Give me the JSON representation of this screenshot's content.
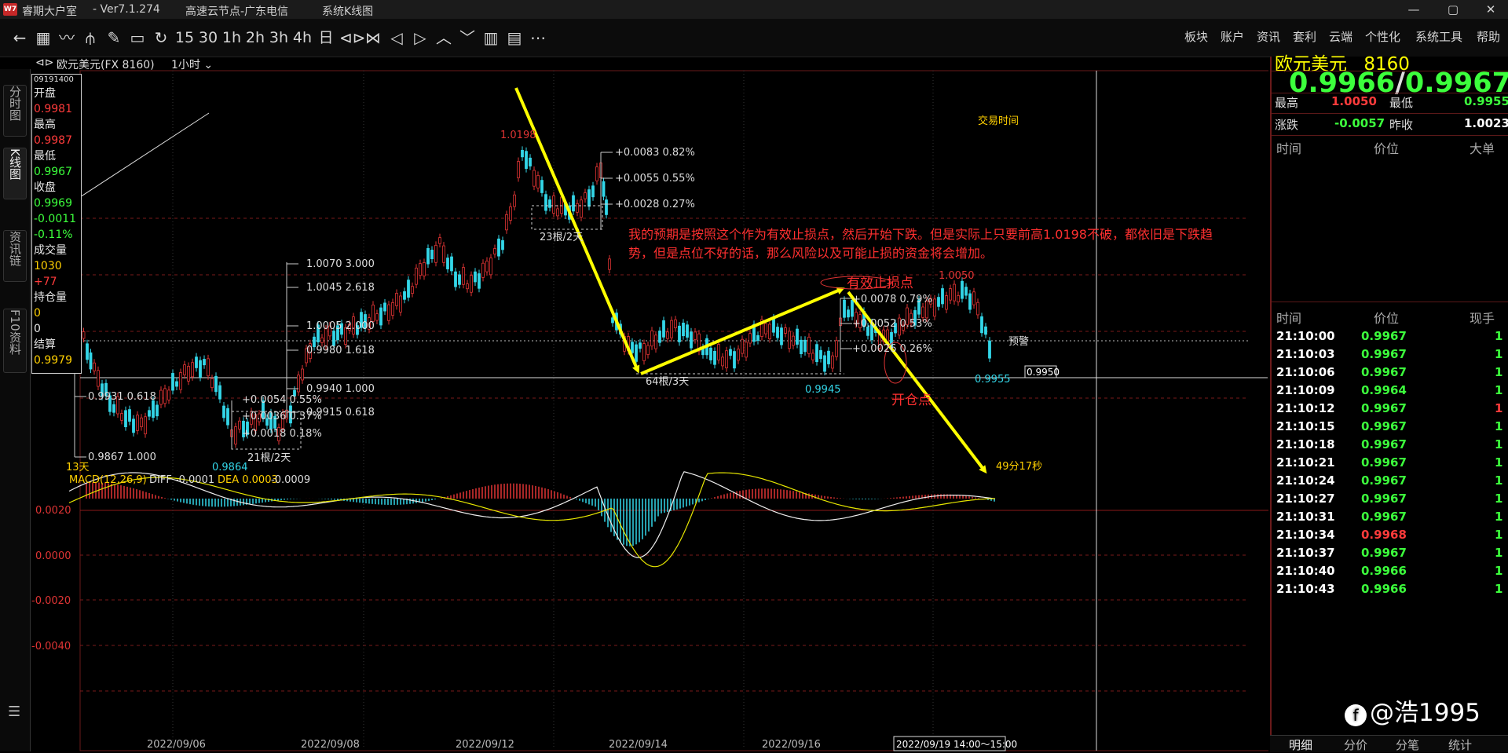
{
  "window": {
    "app_name": "睿期大户室",
    "version": "-  Ver7.1.274",
    "server": "高速云节点-广东电信",
    "module": "系统K线图",
    "logo": "app-logo",
    "controls": [
      "—",
      "▢",
      "✕"
    ]
  },
  "toolbar": {
    "tools": [
      "←",
      "▦",
      "〰",
      "⫛",
      "✎",
      "▭",
      "↻",
      "15",
      "30",
      "1h",
      "2h",
      "3h",
      "4h",
      "日",
      "⊲⊳",
      "⋈",
      "◁",
      "▷",
      "︿",
      "﹀",
      "▥",
      "▤",
      "⋯"
    ],
    "menu": [
      "板块",
      "账户",
      "资讯",
      "套利",
      "云端",
      "个性化",
      "系统工具",
      "帮助"
    ]
  },
  "side_tabs": [
    "分时图",
    "K线图",
    "资讯链",
    "F10资料"
  ],
  "symbol_header": {
    "symbol": "欧元美元(FX 8160)",
    "period": "1小时",
    "trade_time": "交易时间"
  },
  "info_box": {
    "timestamp": "09191400",
    "open_label": "开盘",
    "open": "0.9981",
    "high_label": "最高",
    "high": "0.9987",
    "low_label": "最低",
    "low": "0.9967",
    "close_label": "收盘",
    "close": "0.9969",
    "change": "-0.0011",
    "change_pct": "-0.11%",
    "volume_label": "成交量",
    "volume": "1030",
    "volume_delta": "+77",
    "oi_label": "持仓量",
    "oi": "0",
    "oi2": "0",
    "settle_label": "结算",
    "settle": "0.9979"
  },
  "annotations": {
    "top_high": "1.0198",
    "note_line1": "我的预期是按照这个作为有效止损点，然后开始下跌。但是实际上只要前高1.0198不破，都依旧是下跌趋",
    "note_line2": "势，但是点位不好的话，那么风险以及可能止损的资金将会增加。",
    "stop_label": "有效止损点",
    "open_label": "开仓点",
    "high_1050": "1.0050",
    "low_9945": "0.9945",
    "low_9955": "0.9955",
    "low_9864": "0.9864",
    "days_13": "13天",
    "countdown": "49分17秒",
    "warn": "预警",
    "price_box": "0.9950",
    "fib_top": [
      "+0.0083  0.82%",
      "+0.0055  0.55%",
      "+0.0028  0.27%"
    ],
    "fib_top_label": "23根/2天",
    "fib_left": [
      "1.0070  3.000",
      "1.0045  2.618",
      "1.0005  2.000",
      "0.9980  1.618",
      "0.9940  1.000",
      "0.9915  0.618"
    ],
    "fib_small": [
      "+0.0054  0.55%",
      "+0.0036  0.37%",
      "+0.0018  0.18%"
    ],
    "fib_small_label": "21根/2天",
    "fib_mid_label": "64根/3天",
    "fib_right": [
      "+0.0078  0.79%",
      "+0.0052  0.53%",
      "+0.0026  0.26%"
    ],
    "fib_bl": [
      "0.9931  0.618",
      "0.9867  1.000"
    ]
  },
  "macd": {
    "title": "MACD(12,26,9)",
    "diff": "DIFF -0.0001",
    "dea": "DEA 0.0003",
    "macd": "-0.0009",
    "ticks": [
      "0.0020",
      "0.0000",
      "-0.0020",
      "-0.0040"
    ]
  },
  "x_axis": [
    "2022/09/06",
    "2022/09/08",
    "2022/09/12",
    "2022/09/14",
    "2022/09/16"
  ],
  "cursor_time": "2022/09/19 14:00～15:00",
  "quote": {
    "name": "欧元美元",
    "code": "8160",
    "bid": "0.9966",
    "ask": "0.9967",
    "high_label": "最高",
    "high": "1.0050",
    "low_label": "最低",
    "low": "0.9955",
    "chg_label": "涨跌",
    "chg": "-0.0057",
    "prev_label": "昨收",
    "prev": "1.0023",
    "col_time": "时间",
    "col_price": "价位",
    "col_qty": "大单",
    "col_time2": "时间",
    "col_price2": "价位",
    "col_qty2": "现手"
  },
  "ticks": [
    {
      "time": "21:10:00",
      "price": "0.9967",
      "qty": "1"
    },
    {
      "time": "21:10:03",
      "price": "0.9967",
      "qty": "1"
    },
    {
      "time": "21:10:06",
      "price": "0.9967",
      "qty": "1"
    },
    {
      "time": "21:10:09",
      "price": "0.9964",
      "qty": "1"
    },
    {
      "time": "21:10:12",
      "price": "0.9967",
      "qty": "1"
    },
    {
      "time": "21:10:15",
      "price": "0.9967",
      "qty": "1"
    },
    {
      "time": "21:10:18",
      "price": "0.9967",
      "qty": "1"
    },
    {
      "time": "21:10:21",
      "price": "0.9967",
      "qty": "1"
    },
    {
      "time": "21:10:24",
      "price": "0.9967",
      "qty": "1"
    },
    {
      "time": "21:10:27",
      "price": "0.9967",
      "qty": "1"
    },
    {
      "time": "21:10:31",
      "price": "0.9967",
      "qty": "1"
    },
    {
      "time": "21:10:34",
      "price": "0.9968",
      "qty": "1"
    },
    {
      "time": "21:10:37",
      "price": "0.9967",
      "qty": "1"
    },
    {
      "time": "21:10:40",
      "price": "0.9966",
      "qty": "1"
    },
    {
      "time": "21:10:43",
      "price": "0.9966",
      "qty": "1"
    }
  ],
  "bottom_tabs": [
    "明细",
    "分价",
    "分笔",
    "统计"
  ],
  "watermark": "@浩1995",
  "colors": {
    "up": "#e03434",
    "down": "#33d6e8",
    "accent": "#ffff00",
    "grid": "#7a1a1a"
  }
}
